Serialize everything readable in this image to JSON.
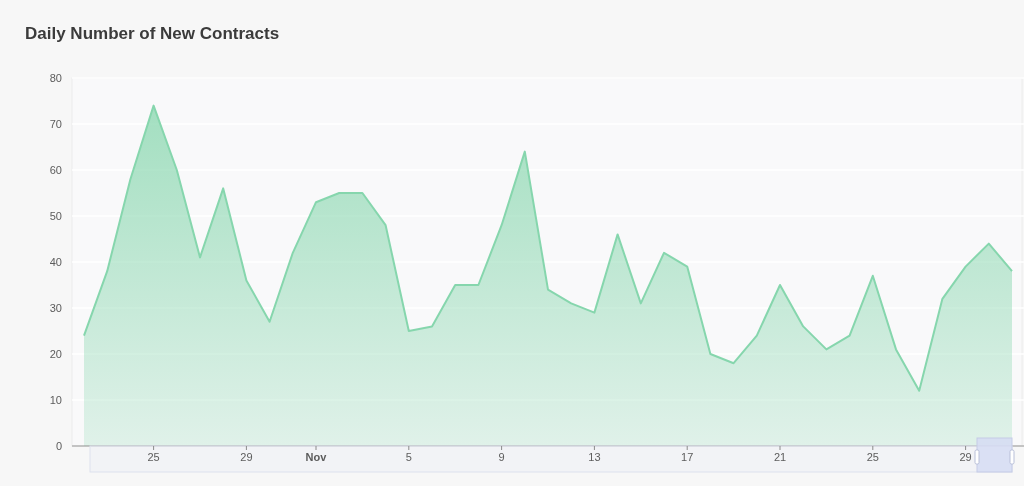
{
  "title": "Daily Number of New Contracts",
  "chart": {
    "chart_data": {
      "type": "area",
      "categories": [
        null,
        null,
        null,
        "25",
        null,
        null,
        null,
        "29",
        null,
        null,
        "Nov",
        null,
        null,
        null,
        "5",
        null,
        null,
        null,
        "9",
        null,
        null,
        null,
        "13",
        null,
        null,
        null,
        "17",
        null,
        null,
        null,
        "21",
        null,
        null,
        null,
        "25",
        null,
        null,
        null,
        "29",
        null,
        null
      ],
      "series": [
        {
          "color": "#86d6ad",
          "values": [
            24,
            38,
            58,
            74,
            60,
            41,
            56,
            36,
            27,
            42,
            53,
            55,
            55,
            48,
            25,
            26,
            35,
            35,
            48,
            64,
            34,
            31,
            29,
            46,
            31,
            42,
            39,
            20,
            18,
            24,
            35,
            26,
            21,
            24,
            37,
            21,
            12,
            32,
            39,
            44,
            38
          ]
        }
      ],
      "ylim": [
        0,
        80
      ],
      "grid": true,
      "yticks": [
        0,
        10,
        20,
        30,
        40,
        50,
        60,
        70,
        80
      ]
    }
  }
}
